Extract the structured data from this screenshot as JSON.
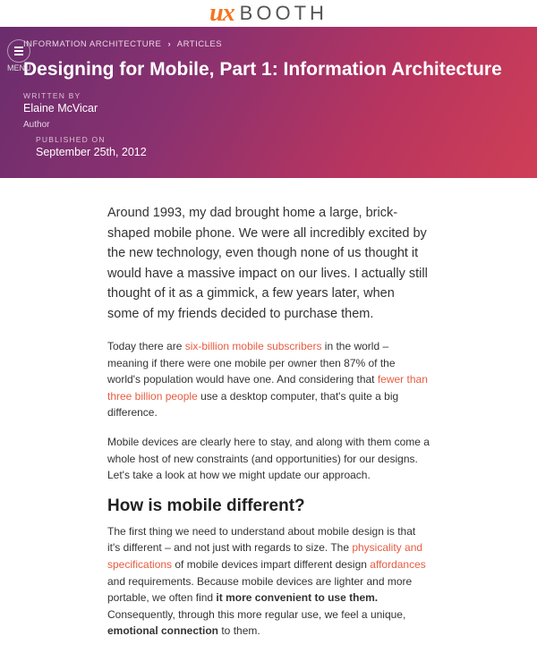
{
  "logo": {
    "prefix": "ux",
    "suffix": "BOOTH"
  },
  "menu": {
    "label": "MENU"
  },
  "breadcrumbs": {
    "category": "INFORMATION ARCHITECTURE",
    "section": "ARTICLES"
  },
  "hero": {
    "title": "Designing for Mobile, Part 1: Information Architecture",
    "written_by_lbl": "WRITTEN BY",
    "written_by": "Elaine McVicar",
    "author_lbl": "Author",
    "published_lbl": "PUBLISHED ON",
    "published": "September 25th, 2012"
  },
  "body": {
    "lede": "Around 1993, my dad brought home a large, brick-shaped mobile phone. We were all incredibly excited by the new technology, even though none of us thought it would have a massive impact on our lives. I actually still thought of it as a gimmick, a few years later, when some of my friends decided to purchase them.",
    "p2_a": "Today there are ",
    "p2_link1": "six-billion mobile subscribers",
    "p2_b": " in the world – meaning if there were one mobile per owner then 87% of the world's population would have one. And considering that ",
    "p2_link2": "fewer than three billion people",
    "p2_c": " use a desktop computer, that's quite a big difference.",
    "p3": "Mobile devices are clearly here to stay, and along with them come a whole host of new constraints (and opportunities) for our designs. Let's take a look at how we might update our approach.",
    "h2": "How is mobile different?",
    "p4_a": "The first thing we need to understand about mobile design is that it's different – and not just with regards to size. The ",
    "p4_link1": "physicality and specifications",
    "p4_b": " of mobile devices impart different design ",
    "p4_link2": "affordances",
    "p4_c": " and requirements. Because mobile devices are lighter and more portable, we often find ",
    "p4_bold1": "it more convenient to use them.",
    "p4_d": " Consequently, through this more regular use, we feel a unique, ",
    "p4_bold2": "emotional connection",
    "p4_e": " to them."
  }
}
